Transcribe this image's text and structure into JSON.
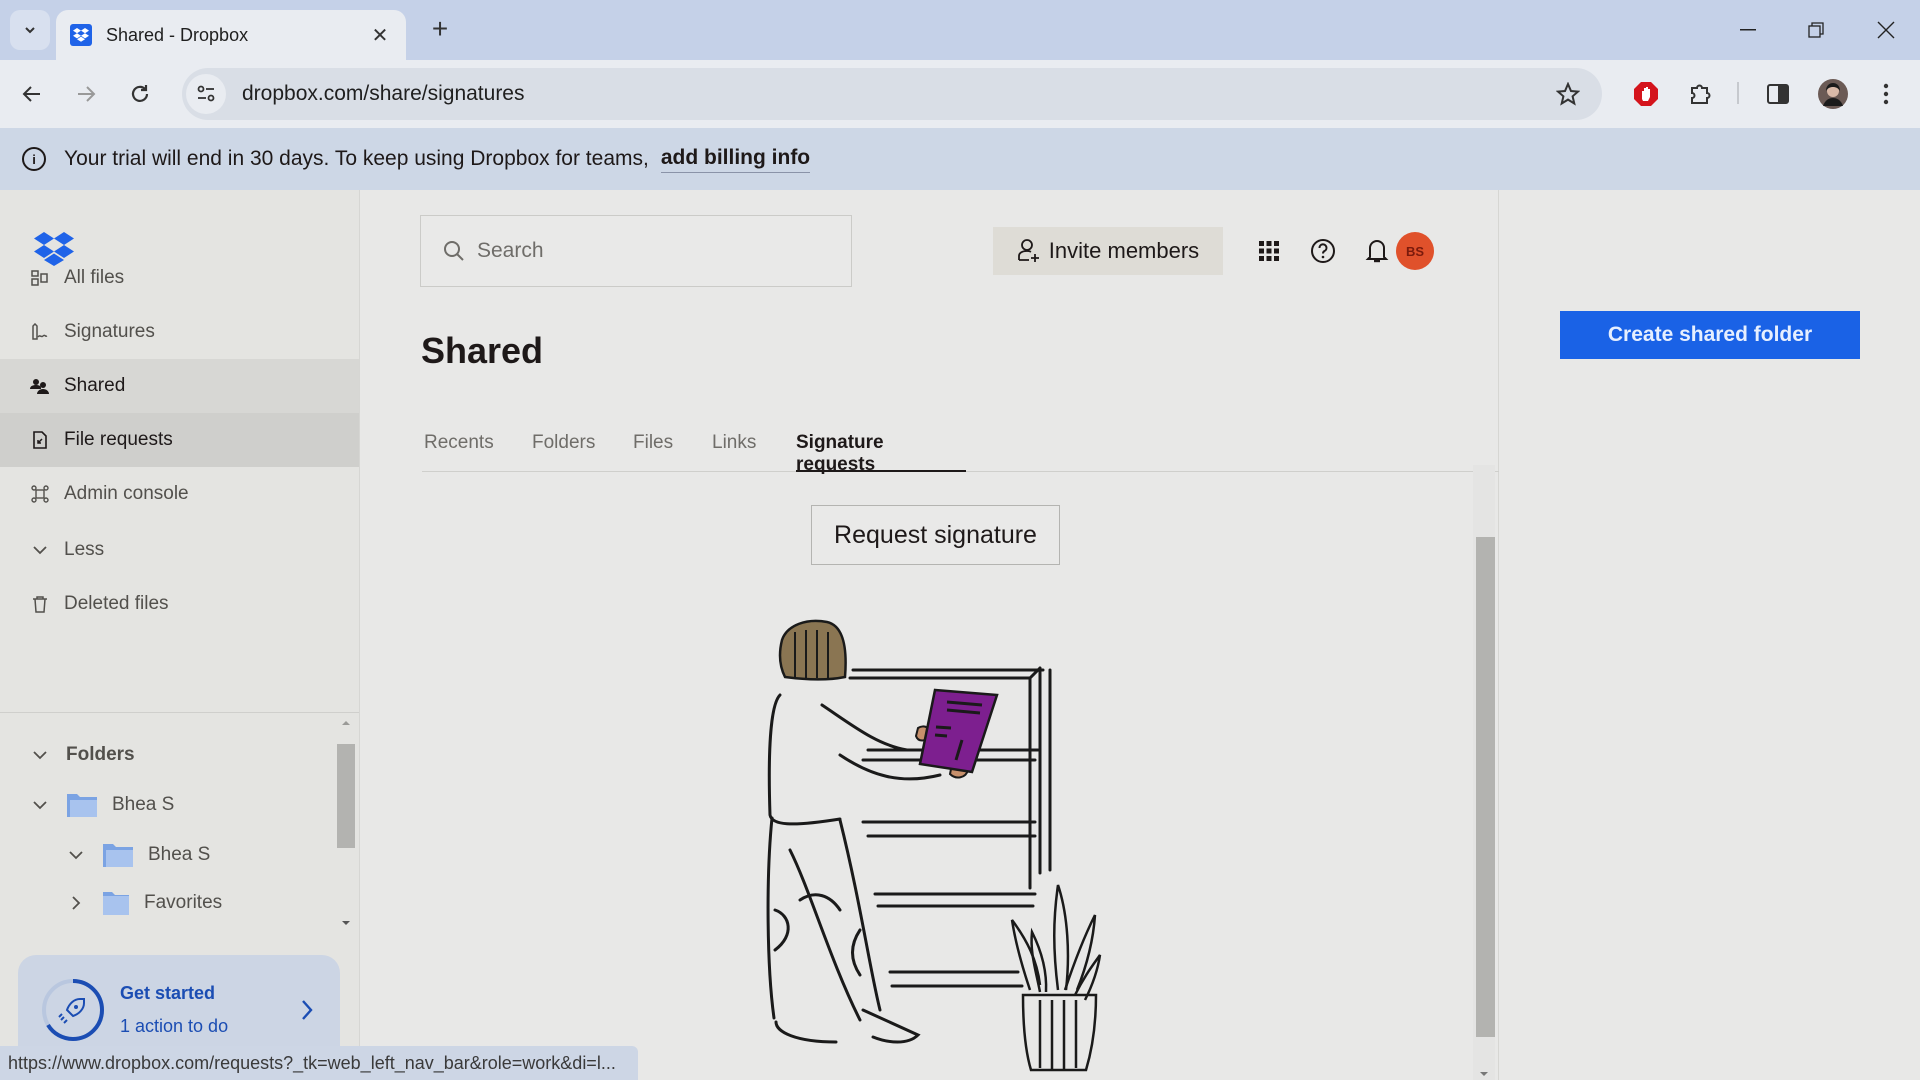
{
  "browser": {
    "tab_title": "Shared - Dropbox",
    "url": "dropbox.com/share/signatures",
    "status_url": "https://www.dropbox.com/requests?_tk=web_left_nav_bar&role=work&di=l..."
  },
  "banner": {
    "text": "Your trial will end in 30 days. To keep using Dropbox for teams,",
    "link": "add billing info"
  },
  "sidebar": {
    "items": [
      {
        "label": "All files",
        "icon": "all-files-icon"
      },
      {
        "label": "Signatures",
        "icon": "signature-icon"
      },
      {
        "label": "Shared",
        "icon": "shared-icon",
        "active": true
      },
      {
        "label": "File requests",
        "icon": "file-request-icon",
        "hover": true
      },
      {
        "label": "Admin console",
        "icon": "admin-console-icon"
      },
      {
        "label": "Less",
        "icon": "chevron-down-icon"
      },
      {
        "label": "Deleted files",
        "icon": "trash-icon"
      }
    ],
    "folders_heading": "Folders",
    "folders": [
      {
        "label": "Bhea S",
        "expanded": true,
        "level": 0
      },
      {
        "label": "Bhea S",
        "expanded": true,
        "level": 1
      },
      {
        "label": "Favorites",
        "expanded": false,
        "level": 1
      }
    ],
    "get_started": {
      "title": "Get started",
      "subtitle": "1 action to do"
    }
  },
  "header": {
    "search_placeholder": "Search",
    "invite_label": "Invite members",
    "avatar_initials": "BS"
  },
  "main": {
    "title": "Shared",
    "tabs": [
      {
        "label": "Recents"
      },
      {
        "label": "Folders"
      },
      {
        "label": "Files"
      },
      {
        "label": "Links"
      },
      {
        "label": "Signature requests",
        "selected": true
      }
    ],
    "request_button": "Request signature"
  },
  "right": {
    "create_button": "Create shared folder"
  },
  "colors": {
    "accent": "#1a62e6",
    "avatar": "#e0512b",
    "book": "#7d1f8f"
  }
}
